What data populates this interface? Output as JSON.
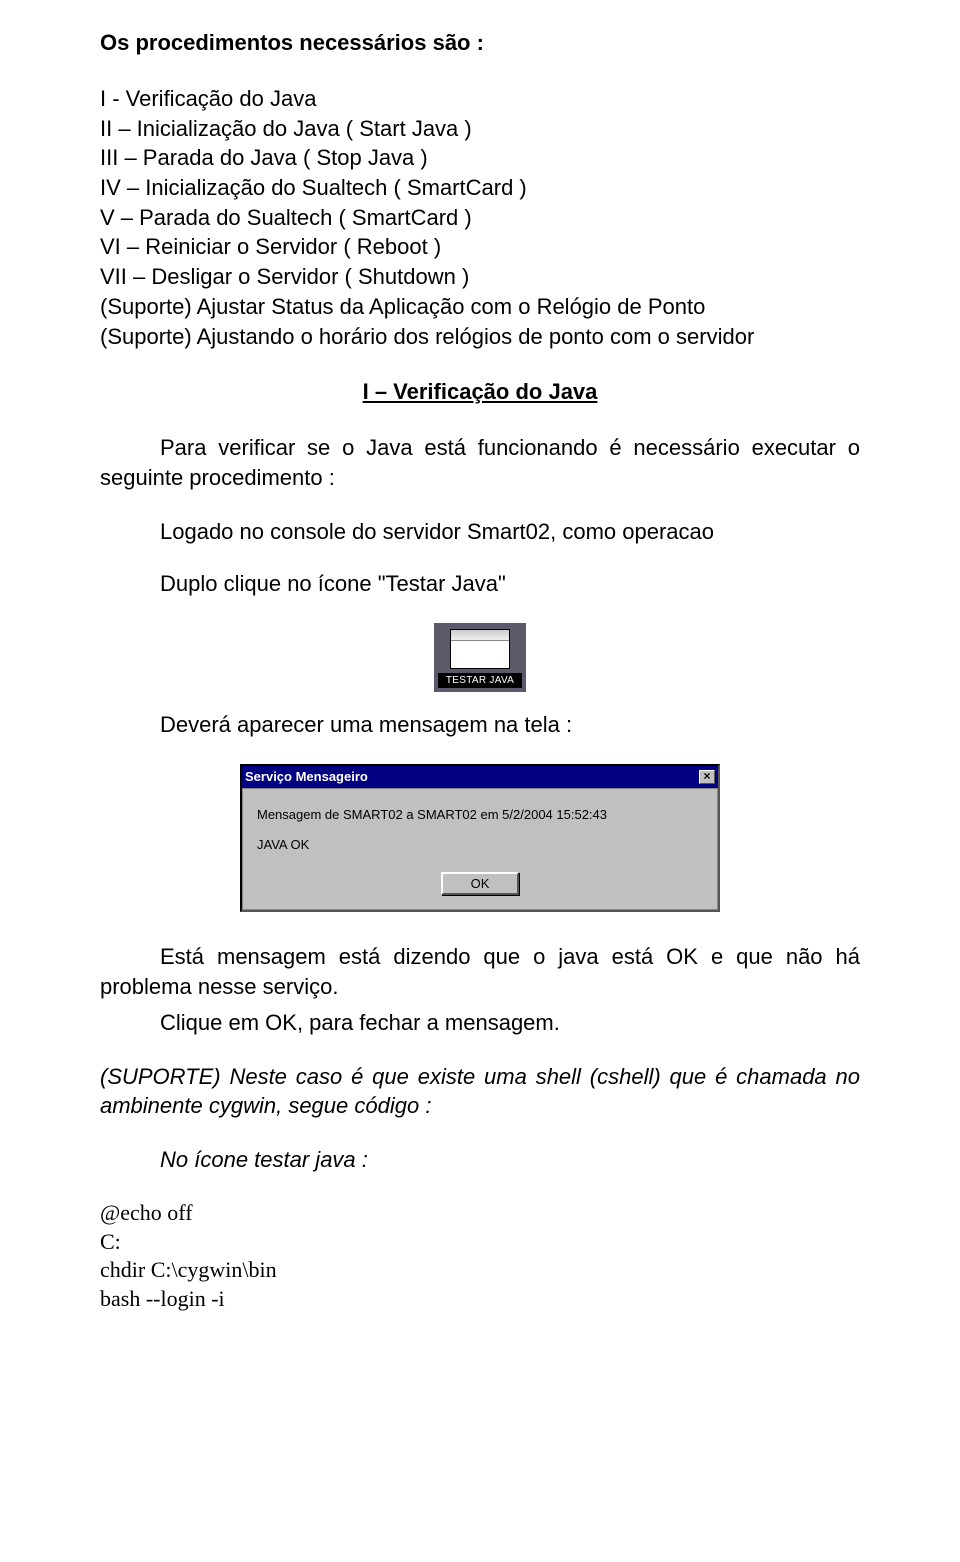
{
  "heading": "Os procedimentos necessários são :",
  "items": [
    "I -  Verificação do Java",
    "II – Inicialização do Java ( Start Java )",
    "III – Parada do Java ( Stop Java )",
    "IV – Inicialização do Sualtech ( SmartCard )",
    "V – Parada do Sualtech ( SmartCard )",
    "VI – Reiniciar o Servidor ( Reboot )",
    "VII – Desligar o Servidor ( Shutdown )",
    "(Suporte) Ajustar Status da Aplicação com o Relógio de Ponto",
    "(Suporte) Ajustando o horário dos relógios de ponto com o servidor"
  ],
  "sectionTitle": "I – Verificação do Java",
  "para1": "Para verificar se o Java está funcionando é necessário executar o seguinte procedimento :",
  "line1": "Logado no console do servidor Smart02, como operacao",
  "line2": "Duplo clique no ícone \"Testar Java\"",
  "iconLabel": "TESTAR JAVA",
  "line3": "Deverá aparecer uma mensagem na tela :",
  "dialog": {
    "title": "Serviço Mensageiro",
    "bodyLine1": "Mensagem de SMART02 a SMART02 em 5/2/2004 15:52:43",
    "bodyLine2": "JAVA OK",
    "okLabel": "OK",
    "closeGlyph": "×"
  },
  "para2": "Está mensagem está dizendo que o java está OK e que não há problema nesse serviço.",
  "line4": "Clique em OK, para fechar a mensagem.",
  "para3": "(SUPORTE) Neste caso é que existe uma shell (cshell) que é chamada no ambinente cygwin, segue código :",
  "line5": "No ícone testar java :",
  "code": [
    "@echo off",
    "C:",
    "chdir C:\\cygwin\\bin",
    "bash --login -i"
  ]
}
